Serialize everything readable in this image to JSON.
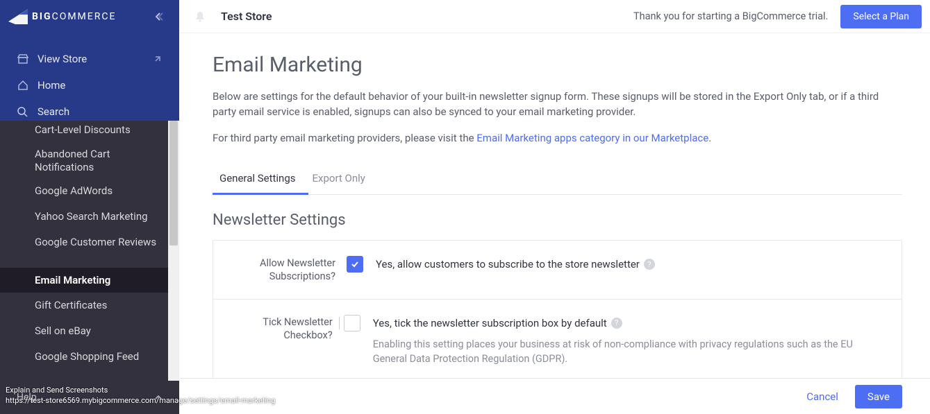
{
  "brand": {
    "name": "BIGCOMMERCE",
    "bold": "BIG",
    "rest": "COMMERCE"
  },
  "topnav": {
    "view_store": "View Store",
    "home": "Home",
    "search": "Search"
  },
  "sidebar": {
    "items": [
      {
        "label": "Cart-Level Discounts"
      },
      {
        "label": "Abandoned Cart Notifications"
      },
      {
        "label": "Google AdWords"
      },
      {
        "label": "Yahoo Search Marketing"
      },
      {
        "label": "Google Customer Reviews"
      },
      {
        "label": "Email Marketing",
        "active": true
      },
      {
        "label": "Gift Certificates"
      },
      {
        "label": "Sell on eBay"
      },
      {
        "label": "Google Shopping Feed"
      }
    ],
    "help": "Help"
  },
  "topbar": {
    "store": "Test Store",
    "trial": "Thank you for starting a BigCommerce trial.",
    "select_plan": "Select a Plan"
  },
  "page": {
    "title": "Email Marketing",
    "intro1": "Below are settings for the default behavior of your built-in newsletter signup form. These signups will be stored in the Export Only tab, or if a third party email service is enabled, signups can also be synced to your email marketing provider.",
    "intro2_pre": "For third party email marketing providers, please visit the ",
    "intro2_link": "Email Marketing apps category in our Marketplace",
    "intro2_post": "."
  },
  "tabs": {
    "general": "General Settings",
    "export": "Export Only"
  },
  "section": {
    "title": "Newsletter Settings"
  },
  "fields": {
    "allow": {
      "label": "Allow Newsletter Subscriptions?",
      "text": "Yes, allow customers to subscribe to the store newsletter",
      "checked": true
    },
    "tick": {
      "label": "Tick Newsletter Checkbox?",
      "text": "Yes, tick the newsletter subscription box by default",
      "hint": "Enabling this setting places your business at risk of non-compliance with privacy regulations such as the EU General Data Protection Regulation (GDPR).",
      "checked": false
    }
  },
  "footer": {
    "cancel": "Cancel",
    "save": "Save"
  },
  "overlay": {
    "line1": "Explain and Send Screenshots",
    "line2": "https://test-store6569.mybigcommerce.com/manage/settings/email-marketing"
  }
}
